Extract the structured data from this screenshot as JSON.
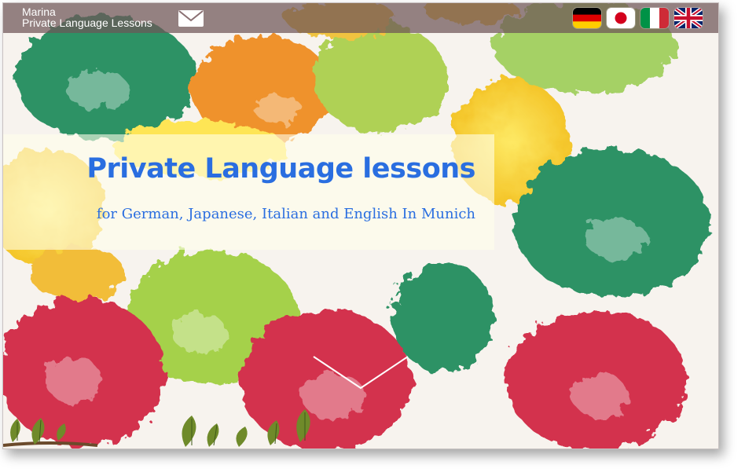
{
  "header": {
    "brand_name": "Marina",
    "brand_tagline": "Private Language Lessons",
    "mail_icon": "envelope-icon",
    "flags": [
      {
        "language": "German",
        "icon": "flag-germany-icon"
      },
      {
        "language": "Japanese",
        "icon": "flag-japan-icon"
      },
      {
        "language": "Italian",
        "icon": "flag-italy-icon"
      },
      {
        "language": "English",
        "icon": "flag-uk-icon"
      }
    ]
  },
  "hero": {
    "title": "Private Language lessons",
    "subtitle": "for German, Japanese, Italian and English In Munich"
  },
  "scroll_icon": "chevron-down-icon",
  "colors": {
    "topbar": "#6e5558",
    "accent_blue": "#2a6ee0",
    "paint_green": "#1f8a5a",
    "paint_red": "#d0243f",
    "paint_yellow": "#f3c51a",
    "paint_orange": "#ef8a1e",
    "paint_lime": "#8cc63f"
  }
}
